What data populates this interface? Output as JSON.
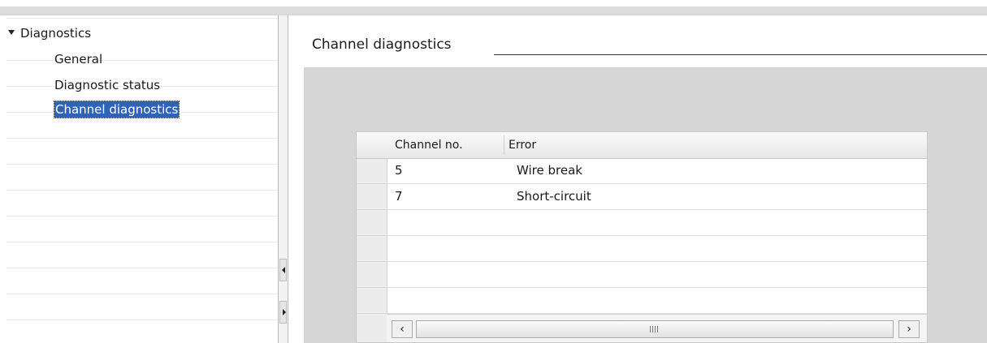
{
  "navigation": {
    "group_label": "Diagnostics",
    "items": [
      {
        "label": "General"
      },
      {
        "label": "Diagnostic status"
      },
      {
        "label": "Channel diagnostics"
      }
    ]
  },
  "content": {
    "section_title": "Channel diagnostics",
    "table": {
      "columns": [
        "Channel no.",
        "Error"
      ],
      "rows": [
        {
          "channel": "5",
          "error": "Wire break"
        },
        {
          "channel": "7",
          "error": "Short-circuit"
        }
      ]
    },
    "scrollbar": {
      "left_icon": "‹",
      "right_icon": "›",
      "grip_icon": "grip-icon"
    }
  },
  "colors": {
    "selection": "#2f63b8",
    "panel": "#d6d6d6"
  }
}
